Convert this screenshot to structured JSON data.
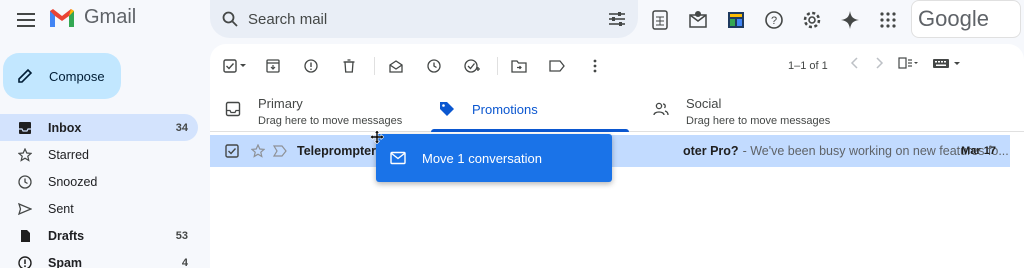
{
  "app": {
    "logo_text": "Gmail",
    "google_text": "Google"
  },
  "search": {
    "placeholder": "Search mail"
  },
  "compose": {
    "label": "Compose"
  },
  "nav": [
    {
      "label": "Inbox",
      "count": "34",
      "icon": "inbox-icon"
    },
    {
      "label": "Starred",
      "count": "",
      "icon": "star-icon"
    },
    {
      "label": "Snoozed",
      "count": "",
      "icon": "clock-icon"
    },
    {
      "label": "Sent",
      "count": "",
      "icon": "send-icon"
    },
    {
      "label": "Drafts",
      "count": "53",
      "icon": "draft-icon"
    },
    {
      "label": "Spam",
      "count": "4",
      "icon": "spam-icon"
    }
  ],
  "toolbar": {
    "pagination": "1–1 of 1"
  },
  "tabs": {
    "primary": {
      "title": "Primary",
      "sub": "Drag here to move messages"
    },
    "promotions": {
      "title": "Promotions"
    },
    "social": {
      "title": "Social",
      "sub": "Drag here to move messages"
    }
  },
  "email": {
    "sender": "Teleprompter",
    "subject": "oter Pro?",
    "snippet": "- We've been busy working on new features fo...",
    "date": "Mar 17"
  },
  "drag": {
    "label": "Move 1 conversation"
  },
  "colors": {
    "accent": "#0b57d0",
    "selected_row": "#c2dbff",
    "drag_bg": "#1a73e8",
    "compose_bg": "#c2e7ff"
  }
}
